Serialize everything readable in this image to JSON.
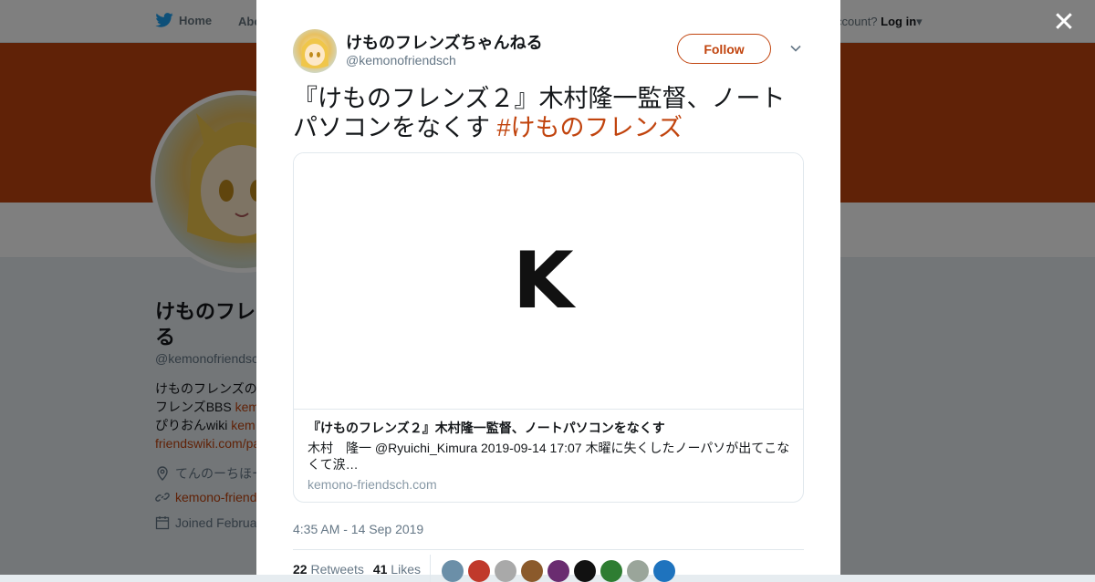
{
  "background": {
    "nav": {
      "home": "Home",
      "about": "Abo",
      "account_prompt": "ccount?",
      "login": "Log in"
    },
    "profile": {
      "name": "けものフレ\nる",
      "handle": "@kemonofriendsc",
      "bio_lines": [
        "けものフレンズの",
        "フレンズBBS ",
        "ぴりおんwiki ",
        "friendswiki.com/pa"
      ],
      "bio_links": [
        "kem",
        "kem"
      ],
      "location": "てんのーちほー",
      "website": "kemono-friend",
      "joined": "Joined Februa"
    }
  },
  "modal": {
    "close_icon": "close-icon",
    "author": {
      "name": "けものフレンズちゃんねる",
      "handle": "@kemonofriendsch"
    },
    "follow_label": "Follow",
    "tweet": {
      "text": "『けものフレンズ２』木村隆一監督、ノートパソコンをなくす ",
      "hashtag": "#けものフレンズ"
    },
    "card": {
      "image_letter": "K",
      "title": "『けものフレンズ２』木村隆一監督、ノートパソコンをなくす",
      "description": "木村　隆一 @Ryuichi_Kimura 2019-09-14 17:07 木曜に失くしたノーパソが出てこなくて涙…",
      "domain": "kemono-friendsch.com"
    },
    "timestamp": "4:35 AM - 14 Sep 2019",
    "stats": {
      "retweets_count": "22",
      "retweets_label": "Retweets",
      "likes_count": "41",
      "likes_label": "Likes"
    },
    "likers": [
      "#6b8fa8",
      "#c0392b",
      "#a9a9a9",
      "#8b5a2b",
      "#6a2c70",
      "#111111",
      "#2e7d32",
      "#9aa59a",
      "#1e73be"
    ]
  }
}
